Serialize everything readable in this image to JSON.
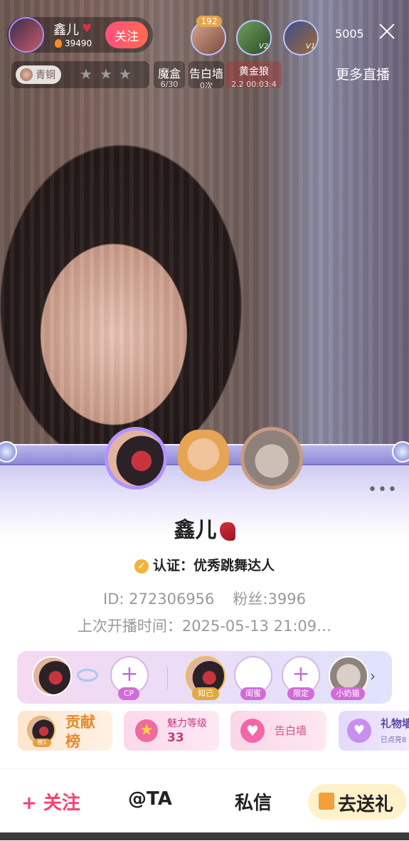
{
  "header": {
    "host_name": "鑫儿",
    "host_score": "39490",
    "follow_label": "关注",
    "viewer_badge": "192",
    "viewer_levels": [
      "V2",
      "V1"
    ],
    "viewer_count": "5005",
    "close_icon": "close-icon"
  },
  "subbar": {
    "rank_label": "青铜",
    "tiles": [
      {
        "title": "魔盒",
        "sub": "6/30"
      },
      {
        "title": "告白墙",
        "sub": "0次"
      },
      {
        "title": "黄金狼",
        "sub": "2.2 00:03:4"
      }
    ],
    "more_live": "更多直播"
  },
  "profile": {
    "name": "鑫儿",
    "cert_label": "认证：优秀跳舞达人",
    "id_text": "ID: 272306956",
    "fans_text": "粉丝:3996",
    "last_live": "上次开播时间：2025-05-13 21:09…"
  },
  "relations": {
    "cp_label": "CP",
    "slots": [
      "知己",
      "闺蜜",
      "限定",
      "小奶猫"
    ]
  },
  "cards": {
    "contrib_label": "贡献榜",
    "contrib_rank": "榜1",
    "charm_label": "魅力等级",
    "charm_value": "33",
    "wall_label": "告白墙",
    "giftwall_label": "礼物墙",
    "giftwall_sub": "已点亮8"
  },
  "actions": {
    "follow": "+ 关注",
    "at": "@TA",
    "dm": "私信",
    "gift": "去送礼"
  }
}
